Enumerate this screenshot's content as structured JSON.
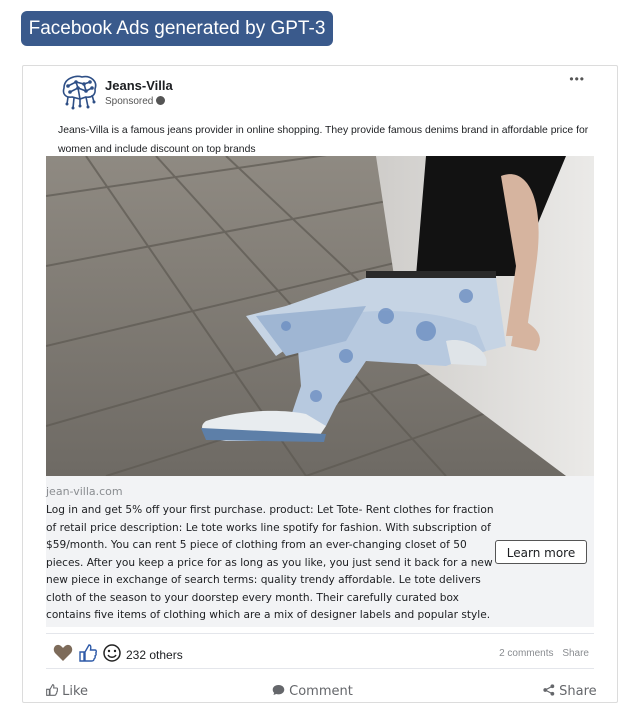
{
  "header": {
    "title": "Facebook Ads generated by GPT-3"
  },
  "post": {
    "page_name": "Jeans-Villa",
    "sponsored": "Sponsored",
    "more_icon": "more-icon",
    "description": "Jeans-Villa is a famous jeans provider in online shopping. They provide famous denims brand in affordable price for women and include discount on top brands",
    "photo_icon": "jeans-photo"
  },
  "ad": {
    "domain": "jean-villa.com",
    "copy": "Log in and get 5% off your first purchase. product: Let Tote- Rent clothes for fraction of retail price description: Le tote works line spotify for fashion. With subscription of $59/month. You can rent 5 piece of clothing from an ever-changing closet of 50 pieces. After you keep a price for as long as you like, you just send it back for a new new piece in exchange of search terms: quality trendy affordable. Le tote delivers cloth of the season to your doorstep every month. Their carefully curated box contains five items of clothing which are a mix of designer labels and popular style.",
    "cta": "Learn more"
  },
  "engagement": {
    "others": "232 others",
    "comments": "2 comments",
    "share": "Share"
  },
  "actions": {
    "like": "Like",
    "comment": "Comment",
    "share": "Share"
  }
}
